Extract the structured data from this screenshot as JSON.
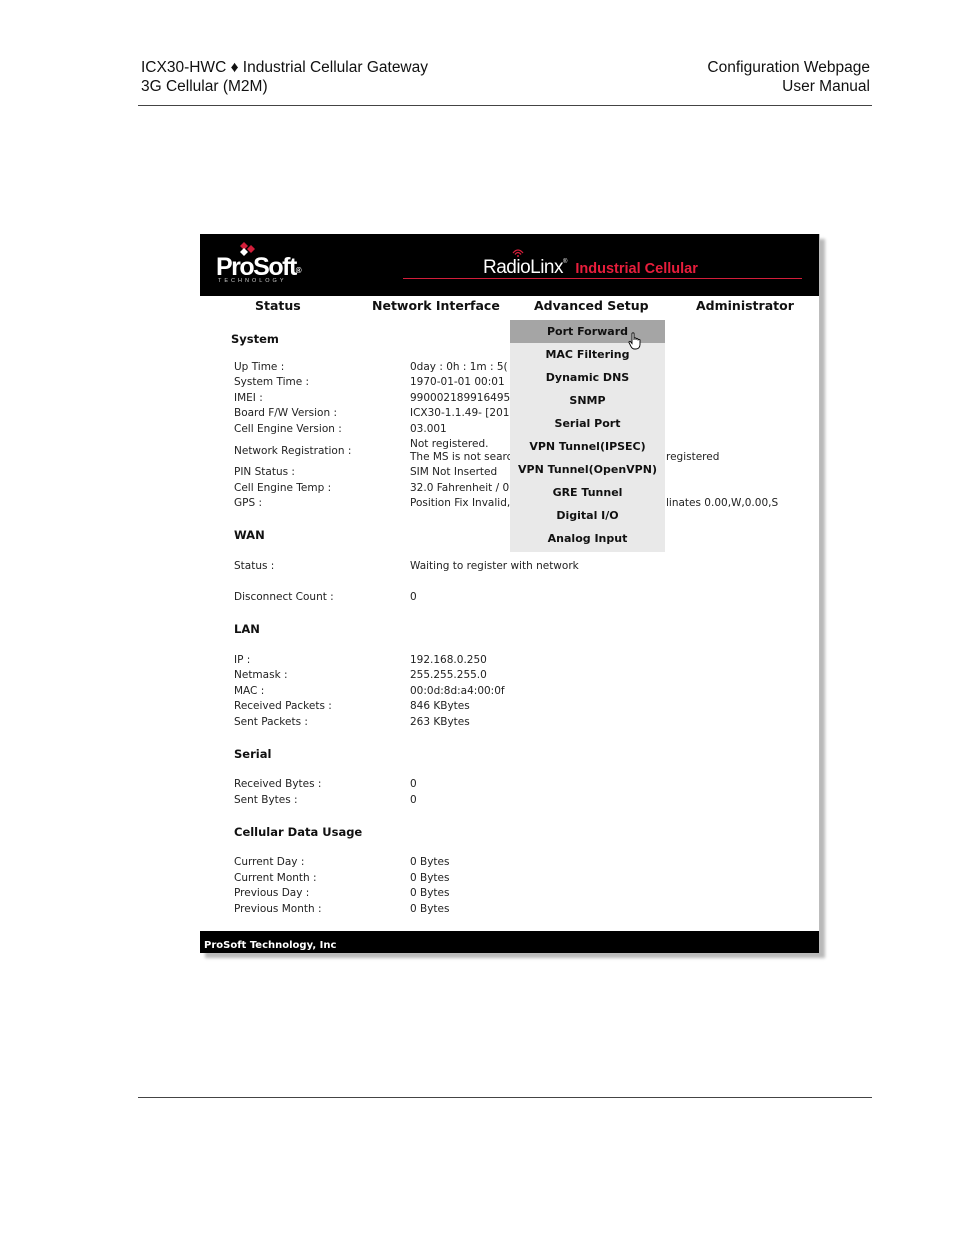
{
  "document": {
    "header_left_line1": "ICX30-HWC ♦ Industrial Cellular Gateway",
    "header_left_line2": "3G Cellular (M2M)",
    "header_right_line1": "Configuration Webpage",
    "header_right_line2": "User Manual"
  },
  "banner": {
    "logo": "ProSoft",
    "logo_mark": "®",
    "logo_sub": "TECHNOLOGY",
    "product_name": "RadioLinx",
    "product_mark": "®",
    "product_sub": "Industrial Cellular"
  },
  "nav": {
    "items": [
      "Status",
      "Network Interface",
      "Advanced Setup",
      "Administrator"
    ]
  },
  "dropdown": {
    "items": [
      "Port Forward",
      "MAC Filtering",
      "Dynamic DNS",
      "SNMP",
      "Serial Port",
      "VPN Tunnel(IPSEC)",
      "VPN Tunnel(OpenVPN)",
      "GRE Tunnel",
      "Digital I/O",
      "Analog Input"
    ],
    "selected": "Port Forward"
  },
  "system": {
    "title": "System",
    "rows": [
      {
        "label": "Up Time :",
        "value": "0day : 0h : 1m : 5("
      },
      {
        "label": "System Time :",
        "value": "1970-01-01   00:01"
      },
      {
        "label": "IMEI :",
        "value": "990002189916495"
      },
      {
        "label": "Board F/W Version :",
        "value": "ICX30-1.1.49- [201"
      },
      {
        "label": "Cell Engine Version :",
        "value": "03.001"
      },
      {
        "label": "Network Registration :",
        "value": "Not registered.",
        "value2": "The MS is not searc",
        "spill": "registered"
      },
      {
        "label": "PIN Status :",
        "value": "SIM Not Inserted"
      },
      {
        "label": "Cell Engine Temp :",
        "value": "32.0 Fahrenheit / 0"
      },
      {
        "label": "GPS :",
        "value": "Position Fix Invalid,",
        "spill": "linates 0.00,W,0.00,S"
      }
    ]
  },
  "wan": {
    "title": "WAN",
    "rows": [
      {
        "label": "Status :",
        "value": "Waiting to register with network"
      },
      {
        "label": "Disconnect Count :",
        "value": "0"
      }
    ]
  },
  "lan": {
    "title": "LAN",
    "rows": [
      {
        "label": "IP :",
        "value": "192.168.0.250"
      },
      {
        "label": "Netmask :",
        "value": "255.255.255.0"
      },
      {
        "label": "MAC :",
        "value": "00:0d:8d:a4:00:0f"
      },
      {
        "label": "Received Packets :",
        "value": "846 KBytes"
      },
      {
        "label": "Sent Packets :",
        "value": "263 KBytes"
      }
    ]
  },
  "serial": {
    "title": "Serial",
    "rows": [
      {
        "label": "Received Bytes :",
        "value": "0"
      },
      {
        "label": "Sent Bytes :",
        "value": "0"
      }
    ]
  },
  "usage": {
    "title": "Cellular Data Usage",
    "rows": [
      {
        "label": "Current Day :",
        "value": "0 Bytes"
      },
      {
        "label": "Current Month :",
        "value": "0 Bytes"
      },
      {
        "label": "Previous Day :",
        "value": "0 Bytes"
      },
      {
        "label": "Previous Month :",
        "value": "0 Bytes"
      }
    ]
  },
  "footer": {
    "text": "ProSoft Technology, Inc"
  },
  "colors": {
    "banner": "#000000",
    "accent_red": "#e81e3c",
    "dropdown_bg": "#e9e9e9",
    "dropdown_selected": "#a5a5a5"
  }
}
